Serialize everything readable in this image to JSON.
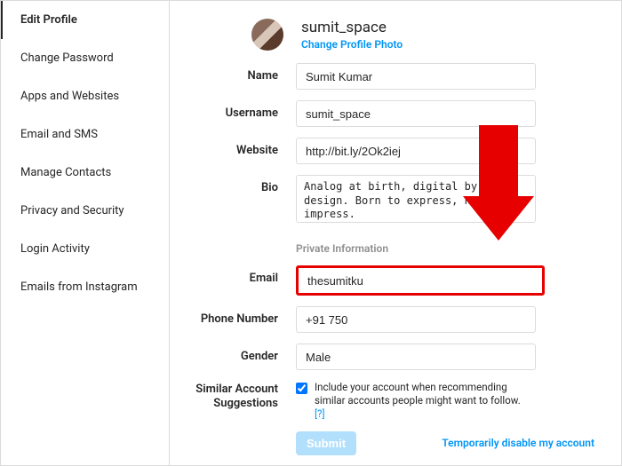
{
  "sidebar": {
    "items": [
      {
        "label": "Edit Profile"
      },
      {
        "label": "Change Password"
      },
      {
        "label": "Apps and Websites"
      },
      {
        "label": "Email and SMS"
      },
      {
        "label": "Manage Contacts"
      },
      {
        "label": "Privacy and Security"
      },
      {
        "label": "Login Activity"
      },
      {
        "label": "Emails from Instagram"
      }
    ]
  },
  "header": {
    "username": "sumit_space",
    "change_photo": "Change Profile Photo"
  },
  "form": {
    "name_label": "Name",
    "name_value": "Sumit Kumar",
    "username_label": "Username",
    "username_value": "sumit_space",
    "website_label": "Website",
    "website_value": "http://bit.ly/2Ok2iej",
    "bio_label": "Bio",
    "bio_value": "Analog at birth, digital by design. Born to express, not to impress.\nWant to get more traffic?",
    "private_section": "Private Information",
    "email_label": "Email",
    "email_value": "thesumitku",
    "phone_label": "Phone Number",
    "phone_value": "+91 750",
    "gender_label": "Gender",
    "gender_value": "Male",
    "suggestions_label": "Similar Account Suggestions",
    "suggestions_text": "Include your account when recommending similar accounts people might want to follow.",
    "suggestions_link": "[?]",
    "submit_label": "Submit",
    "disable_label": "Temporarily disable my account"
  },
  "colors": {
    "accent": "#0095f6",
    "highlight": "#e60000"
  }
}
